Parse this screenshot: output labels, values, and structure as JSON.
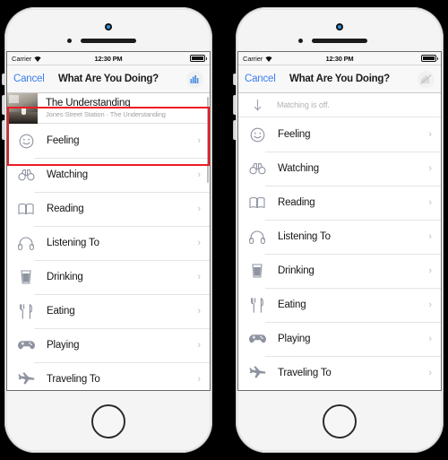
{
  "page": {
    "background_color": "#000000",
    "device_count": 2
  },
  "shared": {
    "status_bar": {
      "carrier": "Carrier",
      "wifi_icon": "wifi-icon",
      "time": "12:30 PM",
      "battery_icon": "battery-full-icon"
    },
    "nav": {
      "cancel_label": "Cancel",
      "title": "What Are You Doing?"
    },
    "activities": [
      {
        "label": "Feeling",
        "icon": "smiley-face-icon",
        "chevron": "›"
      },
      {
        "label": "Watching",
        "icon": "binoculars-icon",
        "chevron": "›"
      },
      {
        "label": "Reading",
        "icon": "open-book-icon",
        "chevron": "›"
      },
      {
        "label": "Listening To",
        "icon": "headphones-icon",
        "chevron": "›"
      },
      {
        "label": "Drinking",
        "icon": "drink-glass-icon",
        "chevron": "›"
      },
      {
        "label": "Eating",
        "icon": "fork-knife-icon",
        "chevron": "›"
      },
      {
        "label": "Playing",
        "icon": "gamepad-icon",
        "chevron": "›"
      },
      {
        "label": "Traveling To",
        "icon": "airplane-icon",
        "chevron": "›"
      }
    ],
    "colors": {
      "cancel_blue": "#3b7df0",
      "active_accent": "#4a90e2",
      "highlight_red": "#ed1c24",
      "icon_grey": "#8e93a0",
      "muted_text": "#b2b2b2"
    }
  },
  "left_phone": {
    "name": "matching-on-state",
    "nav_action_icon": "audio-bars-icon",
    "nav_action_state": "active",
    "highlight_box": "red-callout-box",
    "now_playing": {
      "album_art": "album-artwork-thumbnail",
      "title": "The Understanding",
      "subtitle": "Jones Street Station · The Understanding"
    }
  },
  "right_phone": {
    "name": "matching-off-state",
    "nav_action_icon": "audio-bars-muted-icon",
    "nav_action_state": "disabled",
    "matching_row": {
      "icon": "arrow-down-icon",
      "text": "Matching is off."
    }
  }
}
